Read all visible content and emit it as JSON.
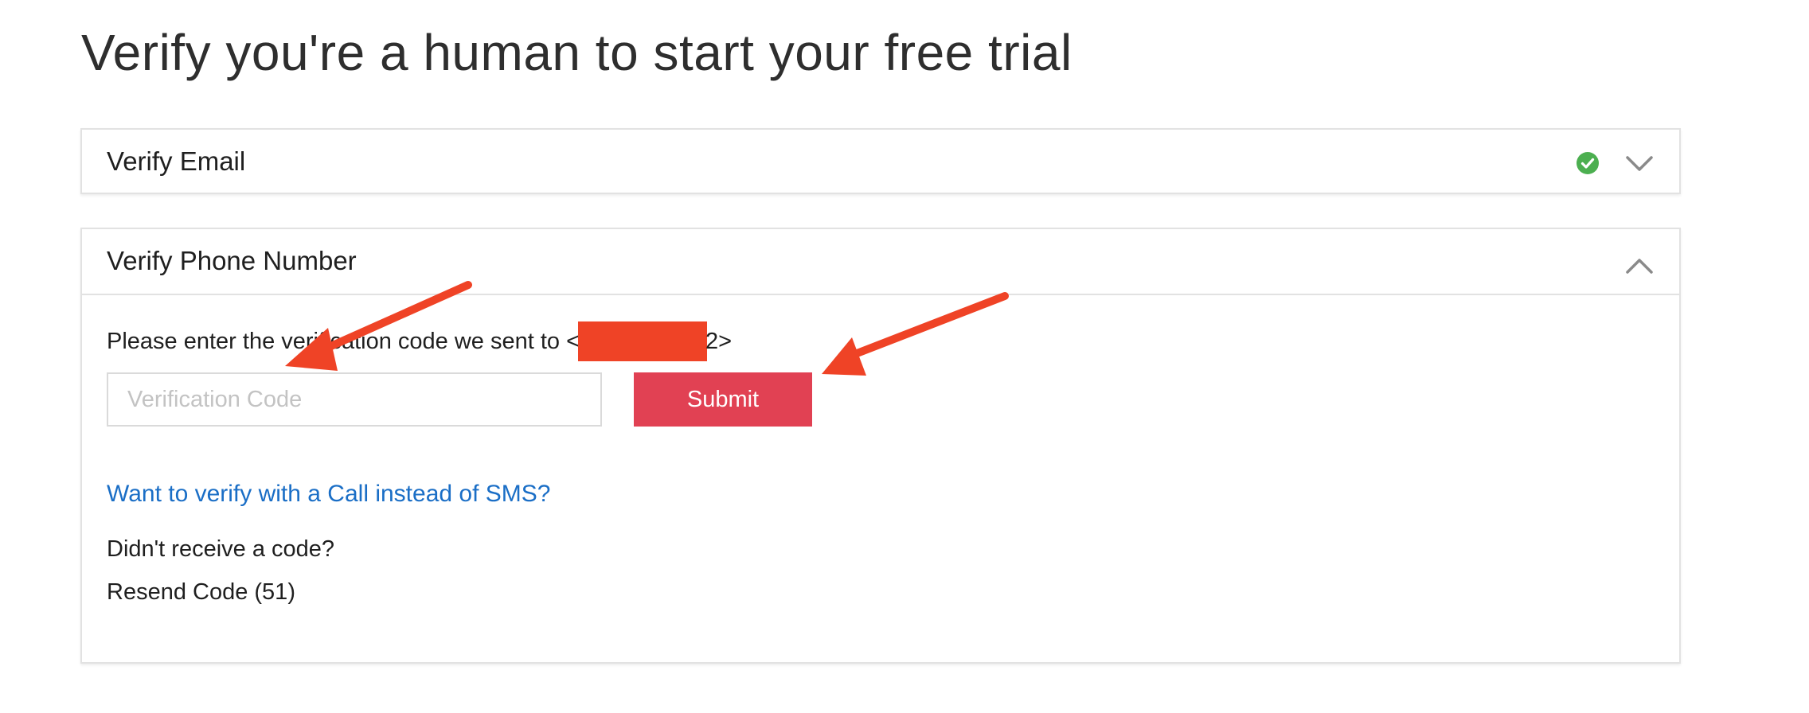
{
  "page": {
    "title": "Verify you're a human to start your free trial"
  },
  "email_section": {
    "title": "Verify Email",
    "status_icon": "check-circle-icon",
    "toggle_icon": "chevron-down-icon",
    "status": "verified"
  },
  "phone_section": {
    "title": "Verify Phone Number",
    "toggle_icon": "chevron-up-icon",
    "instruction_prefix": "Please enter the verification code we sent to <",
    "instruction_suffix": "2>",
    "code_input": {
      "value": "",
      "placeholder": "Verification Code"
    },
    "submit_label": "Submit",
    "call_link": "Want to verify with a Call instead of SMS?",
    "no_code_text": "Didn't receive a code?",
    "resend_label": "Resend Code (51)"
  },
  "colors": {
    "accent_submit": "#e14153",
    "link": "#1a6ec6",
    "success": "#4caf50",
    "annotation_arrow": "#ef4326",
    "redaction": "#ef4326"
  }
}
